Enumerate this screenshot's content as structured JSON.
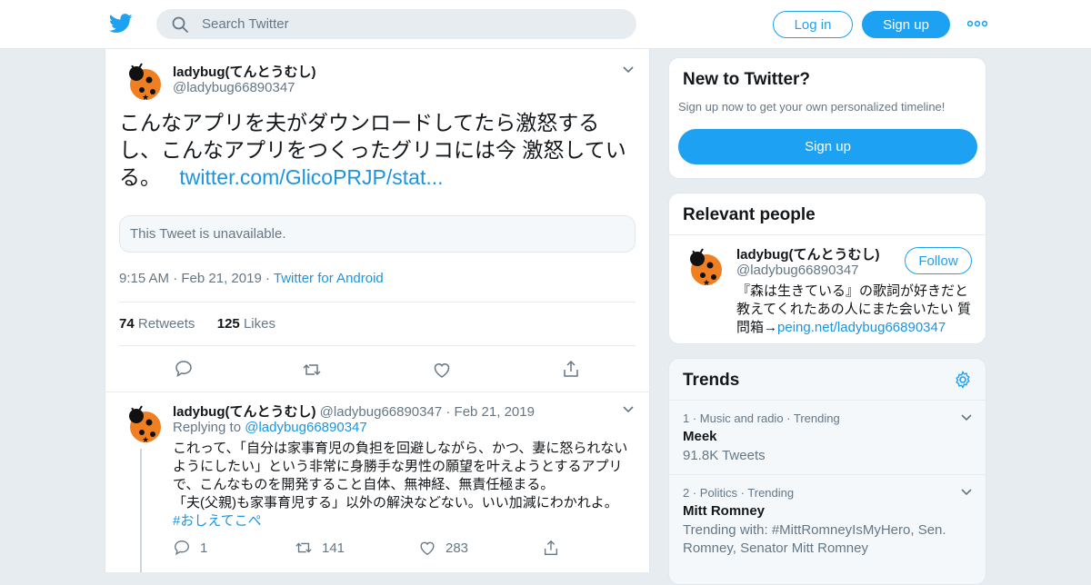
{
  "colors": {
    "accent": "#1da1f2",
    "link": "#1b95e0",
    "muted": "#657786",
    "background": "#e6ecf0"
  },
  "header": {
    "logo_icon": "twitter-bird-icon",
    "search_placeholder": "Search Twitter",
    "login_label": "Log in",
    "signup_label": "Sign up",
    "more_icon": "more-dots-icon"
  },
  "tweet": {
    "author_name": "ladybug(てんとうむし)",
    "author_handle": "@ladybug66890347",
    "text": "こんなアプリを夫がダウンロードしてたら激怒するし、こんなアプリをつくったグリコには今 激怒している。",
    "link": "twitter.com/GlicoPRJP/stat...",
    "quoted_unavailable": "This Tweet is unavailable.",
    "time": "9:15 AM",
    "date": "Feb 21, 2019",
    "source": "Twitter for Android",
    "retweets_count": "74",
    "retweets_label": "Retweets",
    "likes_count": "125",
    "likes_label": "Likes"
  },
  "reply": {
    "author_name": "ladybug(てんとうむし)",
    "author_handle": "@ladybug66890347",
    "date": "Feb 21, 2019",
    "replying_to_label": "Replying to",
    "replying_to_handle": "@ladybug66890347",
    "line1": "これって、「自分は家事育児の負担を回避しながら、かつ、妻に怒られないようにしたい」という非常に身勝手な男性の願望を叶えようとするアプリで、こんなものを開発すること自体、無神経、無責任極まる。",
    "line2": "「夫(父親)も家事育児する」以外の解決などない。いい加減にわかれよ。",
    "hashtag": "#おしえてこぺ",
    "replies": "1",
    "retweets": "141",
    "likes": "283"
  },
  "sidebar": {
    "new_to_twitter": {
      "title": "New to Twitter?",
      "subtitle": "Sign up now to get your own personalized timeline!",
      "button": "Sign up"
    },
    "relevant_people": {
      "title": "Relevant people",
      "name": "ladybug(てんとうむし)",
      "handle": "@ladybug66890347",
      "follow_label": "Follow",
      "bio": "『森は生きている』の歌詞が好きだと教えてくれたあの人にまた会いたい 質問箱→",
      "bio_link": "peing.net/ladybug66890347"
    },
    "trends": {
      "title": "Trends",
      "items": [
        {
          "meta": "1 · Music and radio · Trending",
          "name": "Meek",
          "sub": "91.8K Tweets"
        },
        {
          "meta": "2 · Politics · Trending",
          "name": "Mitt Romney",
          "sub": "Trending with: #MittRomneyIsMyHero, Sen. Romney, Senator Mitt Romney"
        }
      ]
    }
  }
}
